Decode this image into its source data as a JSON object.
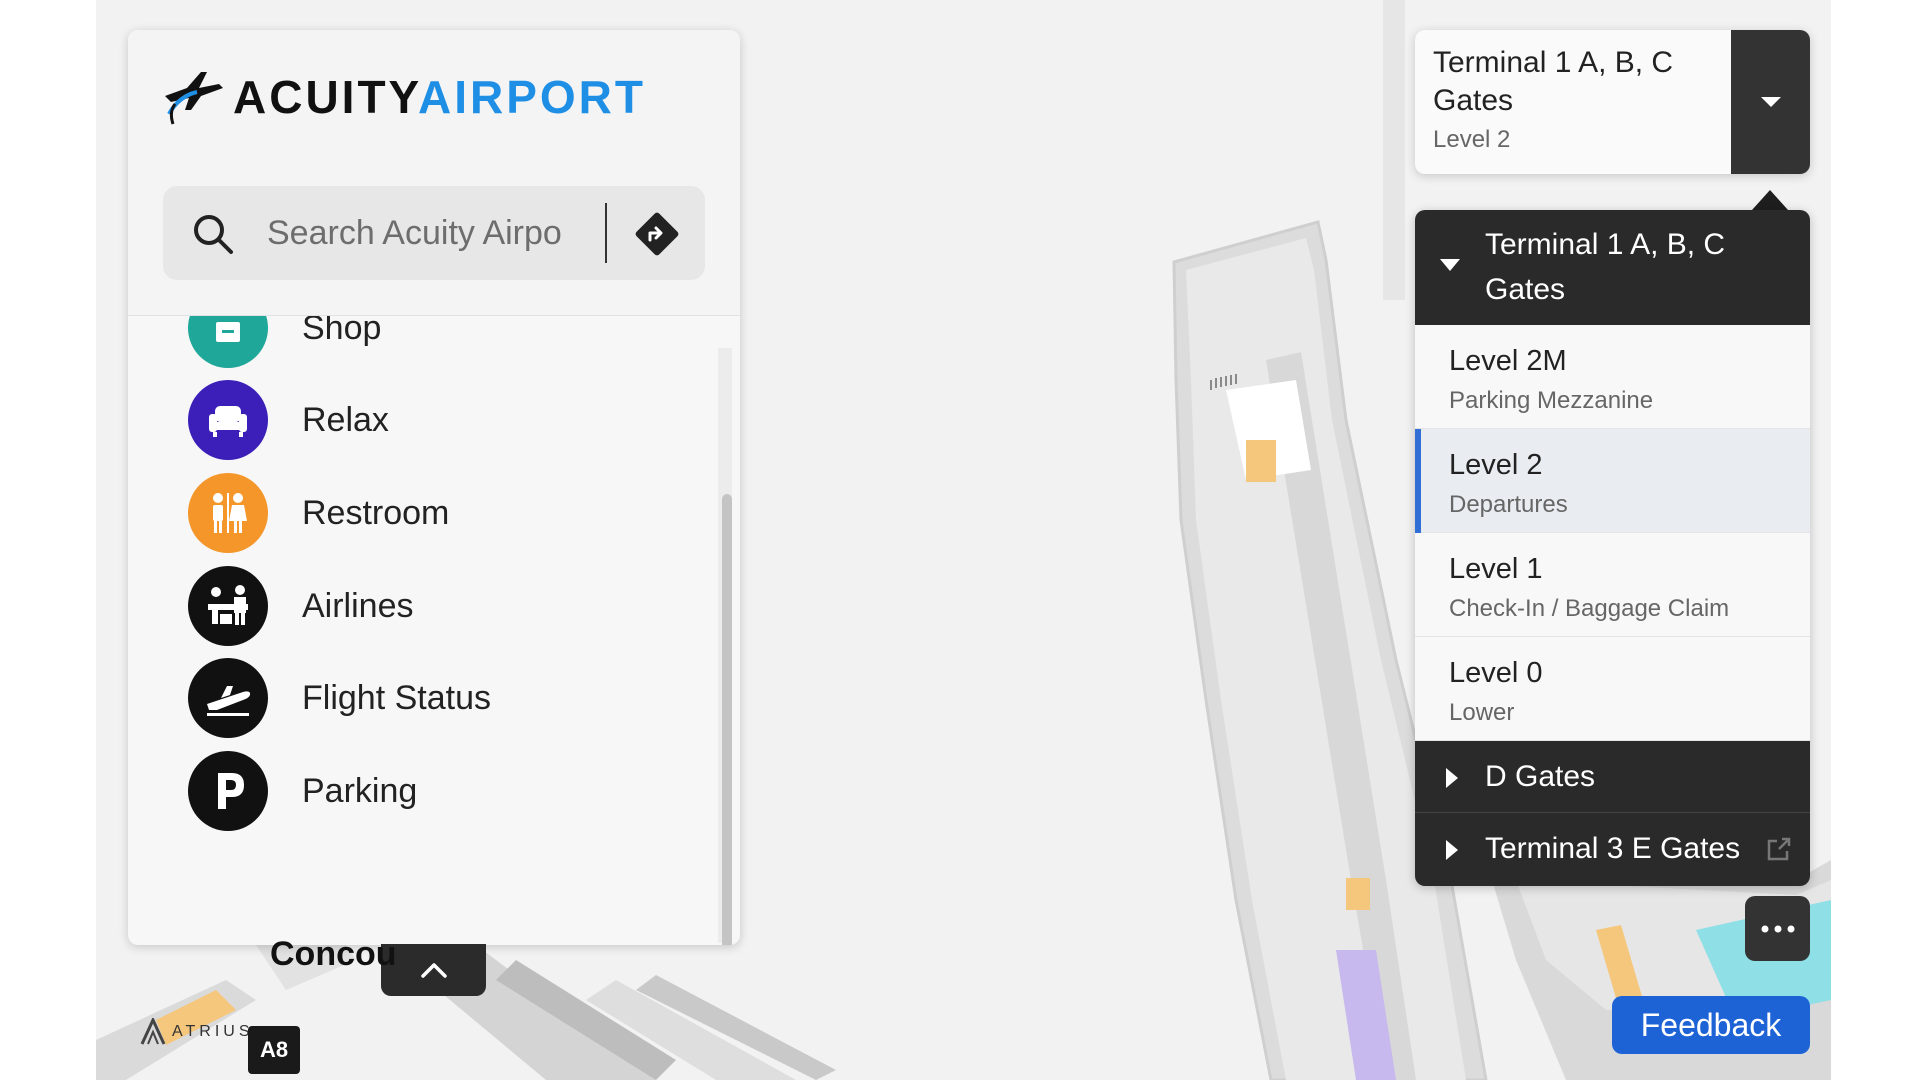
{
  "app": {
    "brand_part1": "ACUITY",
    "brand_part2": "AIRPORT",
    "brand_color": "#1f8fe6"
  },
  "search": {
    "placeholder": "Search Acuity Airpo",
    "value": ""
  },
  "categories": [
    {
      "label": "Shop",
      "icon": "shop-icon",
      "color": "#1fa79a"
    },
    {
      "label": "Relax",
      "icon": "armchair-icon",
      "color": "#3b1fb8"
    },
    {
      "label": "Restroom",
      "icon": "restroom-icon",
      "color": "#f5962b"
    },
    {
      "label": "Airlines",
      "icon": "airline-counter-icon",
      "color": "#111111"
    },
    {
      "label": "Flight Status",
      "icon": "plane-takeoff-icon",
      "color": "#111111"
    },
    {
      "label": "Parking",
      "icon": "parking-icon",
      "color": "#111111"
    }
  ],
  "building_selector": {
    "title": "Terminal 1 A, B, C Gates",
    "level": "Level 2"
  },
  "level_menu": {
    "expanded_building": "Terminal 1 A, B, C Gates",
    "levels": [
      {
        "name": "Level 2M",
        "desc": "Parking Mezzanine",
        "selected": false
      },
      {
        "name": "Level 2",
        "desc": "Departures",
        "selected": true
      },
      {
        "name": "Level 1",
        "desc": "Check-In / Baggage Claim",
        "selected": false
      },
      {
        "name": "Level 0",
        "desc": "Lower",
        "selected": false
      }
    ],
    "collapsed_buildings": [
      "D Gates",
      "Terminal 3 E Gates"
    ]
  },
  "map": {
    "concourse_label": "Concou",
    "gate_badge": "A8",
    "attribution": "ATRIUS"
  },
  "feedback_label": "Feedback",
  "colors": {
    "selected_level_accent": "#2f6fd6",
    "feedback_bg": "#1d63d6"
  }
}
